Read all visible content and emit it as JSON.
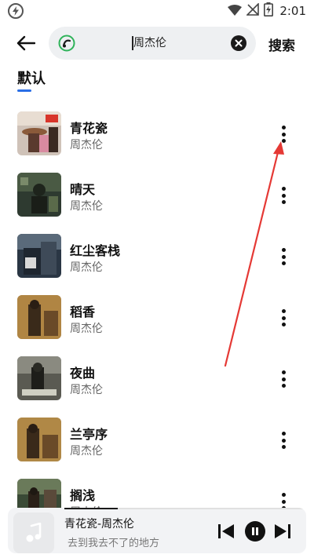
{
  "status_bar": {
    "time": "2:01",
    "icons": [
      "bolt-icon",
      "wifi-icon",
      "no-signal-icon",
      "battery-charging-icon"
    ]
  },
  "search": {
    "query": "周杰伦",
    "action_label": "搜索",
    "icons": [
      "back-arrow-icon",
      "app-logo-icon",
      "clear-icon"
    ]
  },
  "tabs": [
    {
      "label": "默认",
      "active": true,
      "accent": "#2a6ee6"
    }
  ],
  "songs": [
    {
      "title": "青花瓷",
      "artist": "周杰伦",
      "cover_color": "#c9a9a0"
    },
    {
      "title": "晴天",
      "artist": "周杰伦",
      "cover_color": "#3c4a3a"
    },
    {
      "title": "红尘客栈",
      "artist": "周杰伦",
      "cover_color": "#2e3b4a"
    },
    {
      "title": "稻香",
      "artist": "周杰伦",
      "cover_color": "#7a5a2e"
    },
    {
      "title": "夜曲",
      "artist": "周杰伦",
      "cover_color": "#4a4a44"
    },
    {
      "title": "兰亭序",
      "artist": "周杰伦",
      "cover_color": "#7a5a2e"
    },
    {
      "title": "搁浅",
      "artist": "周杰伦",
      "cover_color": "#3a4a36"
    }
  ],
  "player": {
    "title": "青花瓷-周杰伦",
    "lyric": "去到我去不了的地方",
    "progress": 0.22,
    "icons": [
      "music-note-icon",
      "skip-previous-icon",
      "pause-icon",
      "skip-next-icon"
    ]
  },
  "annotation": {
    "color": "#e53935"
  }
}
